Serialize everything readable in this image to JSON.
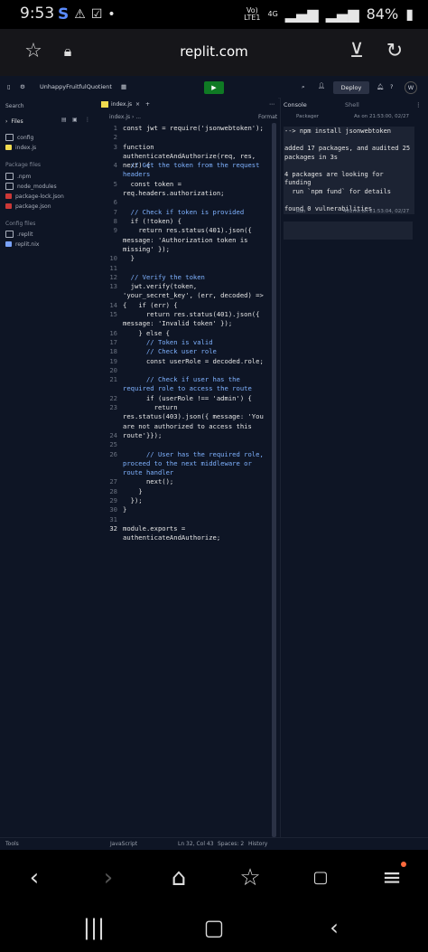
{
  "status": {
    "time": "9:53",
    "lte_top": "Vo)",
    "lte_bottom": "LTE1",
    "net": "4G",
    "battery": "84%"
  },
  "browser": {
    "url": "replit.com"
  },
  "topbar": {
    "project": "UnhappyFruitfulQuotient",
    "deploy": "Deploy",
    "avatar": "W"
  },
  "sidebar": {
    "search": "Search",
    "files_title": "Files",
    "files": [
      "config",
      "index.js"
    ],
    "pkg_title": "Package files",
    "pkg": [
      ".npm",
      "node_modules",
      "package-lock.json",
      "package.json"
    ],
    "cfg_title": "Config files",
    "cfg": [
      ".replit",
      "replit.nix"
    ],
    "tools": "Tools"
  },
  "editor": {
    "tab": "index.js",
    "crumb": "index.js › ...",
    "format": "Format",
    "language": "JavaScript",
    "position": "Ln 32, Col 43",
    "spaces": "Spaces: 2",
    "history": "History"
  },
  "code_lines": [
    {
      "n": "1",
      "y": 0,
      "h": 1,
      "t": "const jwt = require('jsonwebtoken');"
    },
    {
      "n": "2",
      "y": 1,
      "h": 1,
      "t": ""
    },
    {
      "n": "3",
      "y": 2,
      "h": 3,
      "t": "function authenticateAndAuthorize(req, res, next) {"
    },
    {
      "n": "4",
      "y": 4,
      "h": 1,
      "t": "  // Get the token from the request headers"
    },
    {
      "n": "5",
      "y": 6,
      "h": 2,
      "t": "  const token = req.headers.authorization;"
    },
    {
      "n": "6",
      "y": 8,
      "h": 1,
      "t": ""
    },
    {
      "n": "7",
      "y": 9,
      "h": 1,
      "t": "  // Check if token is provided"
    },
    {
      "n": "8",
      "y": 10,
      "h": 1,
      "t": "  if (!token) {"
    },
    {
      "n": "9",
      "y": 11,
      "h": 3,
      "t": "    return res.status(401).json({ message: 'Authorization token is missing' });"
    },
    {
      "n": "10",
      "y": 14,
      "h": 1,
      "t": "  }"
    },
    {
      "n": "11",
      "y": 15,
      "h": 1,
      "t": ""
    },
    {
      "n": "12",
      "y": 16,
      "h": 1,
      "t": "  // Verify the token"
    },
    {
      "n": "13",
      "y": 17,
      "h": 2,
      "t": "  jwt.verify(token, 'your_secret_key', (err, decoded) => {"
    },
    {
      "n": "14",
      "y": 19,
      "h": 1,
      "t": "    if (err) {"
    },
    {
      "n": "15",
      "y": 20,
      "h": 2,
      "t": "      return res.status(401).json({ message: 'Invalid token' });"
    },
    {
      "n": "16",
      "y": 22,
      "h": 1,
      "t": "    } else {"
    },
    {
      "n": "17",
      "y": 23,
      "h": 1,
      "t": "      // Token is valid"
    },
    {
      "n": "18",
      "y": 24,
      "h": 1,
      "t": "      // Check user role"
    },
    {
      "n": "19",
      "y": 25,
      "h": 1,
      "t": "      const userRole = decoded.role;"
    },
    {
      "n": "20",
      "y": 26,
      "h": 1,
      "t": ""
    },
    {
      "n": "21",
      "y": 27,
      "h": 2,
      "t": "      // Check if user has the required role to access the route"
    },
    {
      "n": "22",
      "y": 29,
      "h": 1,
      "t": "      if (userRole !== 'admin') {"
    },
    {
      "n": "23",
      "y": 30,
      "h": 3,
      "t": "        return res.status(403).json({ message: 'You are not authorized to access this route' });"
    },
    {
      "n": "24",
      "y": 33,
      "h": 1,
      "t": "      }"
    },
    {
      "n": "25",
      "y": 34,
      "h": 1,
      "t": ""
    },
    {
      "n": "26",
      "y": 35,
      "h": 3,
      "t": "      // User has the required role, proceed to the next middleware or route handler"
    },
    {
      "n": "27",
      "y": 38,
      "h": 1,
      "t": "      next();"
    },
    {
      "n": "28",
      "y": 39,
      "h": 1,
      "t": "    }"
    },
    {
      "n": "29",
      "y": 40,
      "h": 1,
      "t": "  });"
    },
    {
      "n": "30",
      "y": 41,
      "h": 1,
      "t": "}"
    },
    {
      "n": "31",
      "y": 42,
      "h": 1,
      "t": ""
    },
    {
      "n": "32",
      "y": 43,
      "h": 2,
      "t": "module.exports = authenticateAndAuthorize;"
    }
  ],
  "console": {
    "tab_console": "Console",
    "tab_shell": "Shell",
    "packager_label": "Packager",
    "packager_time": "As on 21:53:00, 02/27",
    "lines": [
      "--> npm install jsonwebtoken",
      "",
      "added 17 packages, and audited 25 packages in 3s",
      "",
      "4 packages are looking for funding",
      "  run `npm fund` for details",
      "",
      "found 0 vulnerabilities"
    ],
    "run_label": "Run",
    "run_time": "401ms on 21:53:04, 02/27"
  },
  "colors": {
    "ide_bg": "#0e1525",
    "run_green": "#0f7a24",
    "keyword": "#c7a0ff",
    "comment": "#7fb2ff"
  }
}
